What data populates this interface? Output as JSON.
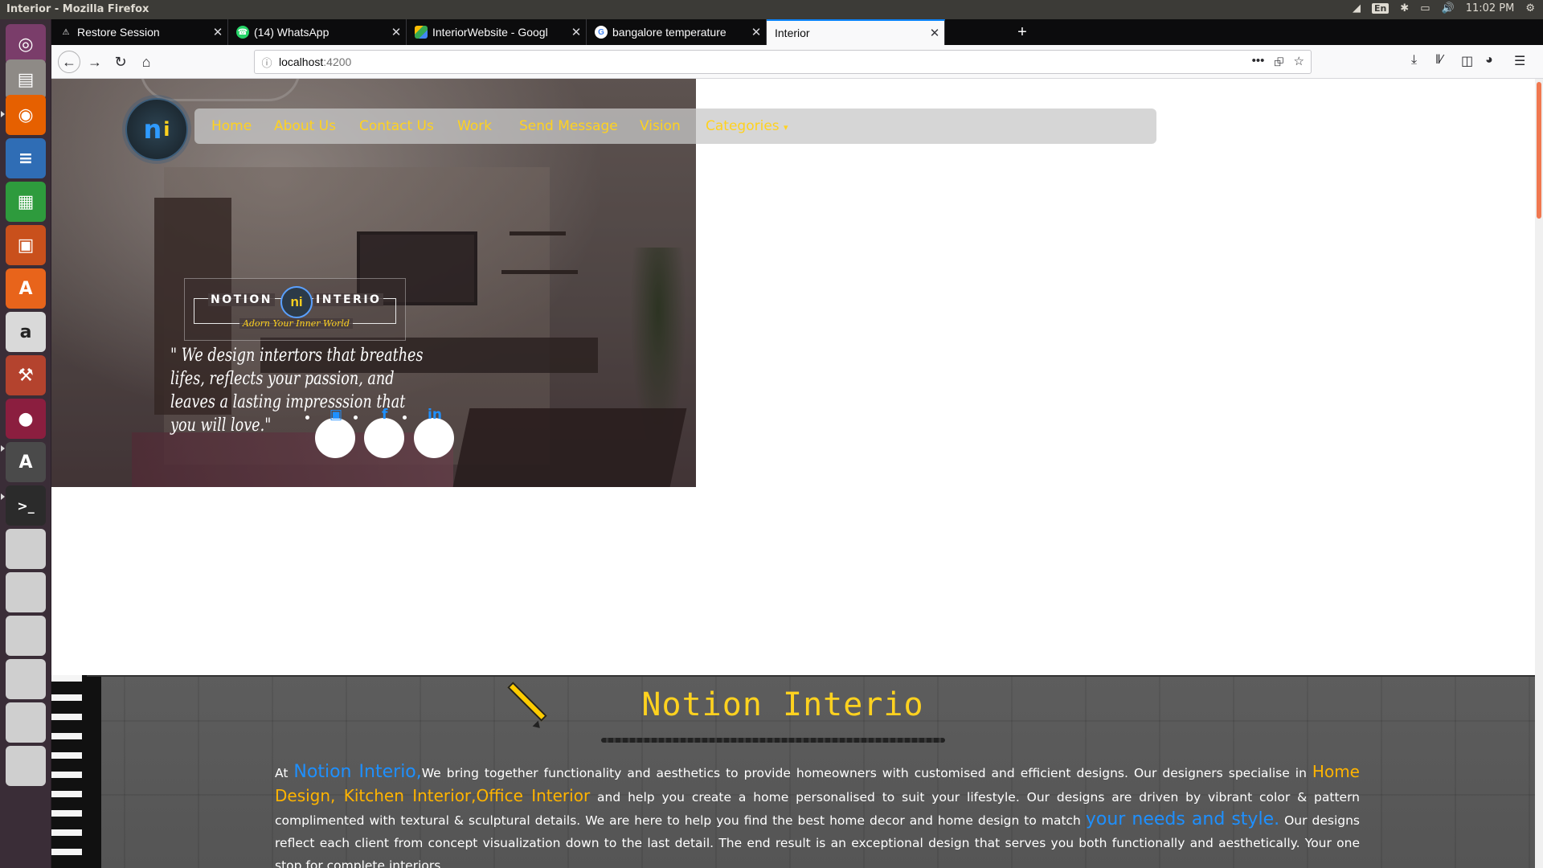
{
  "system": {
    "window_title": "Interior - Mozilla Firefox",
    "keyboard_layout": "En",
    "clock": "11:02 PM"
  },
  "browser": {
    "tabs": [
      {
        "label": "Restore Session",
        "icon": "warning-icon",
        "active": false
      },
      {
        "label": "(14) WhatsApp",
        "icon": "whatsapp-icon",
        "active": false
      },
      {
        "label": "InteriorWebsite - Googl",
        "icon": "google-drive-icon",
        "active": false
      },
      {
        "label": "bangalore temperature",
        "icon": "google-icon",
        "active": false
      },
      {
        "label": "Interior",
        "icon": "none",
        "active": true
      }
    ],
    "url_host": "localhost",
    "url_port": ":4200"
  },
  "site": {
    "nav": {
      "links": [
        "Home",
        "About Us",
        "Contact Us",
        "Work",
        "Send Message",
        "Vision",
        "Categories"
      ]
    },
    "hero": {
      "brand_left": "NOTION",
      "brand_right": "INTERIO",
      "brand_tagline": "Adorn Your Inner World",
      "quote": "\" We design intertors that breathes lifes, reflects your passion, and leaves a lasting impresssion that you will love.\""
    },
    "about": {
      "title": "Notion Interio",
      "p_at": "At ",
      "p_brand": "Notion Interio,",
      "p_1": "We bring together functionality and aesthetics to provide homeowners with customised and efficient designs. Our designers specialise in ",
      "p_services": "Home Design, Kitchen Interior,Office Interior",
      "p_2": " and help you create a home personalised to suit your lifestyle. Our designs are driven by vibrant color & pattern complimented with textural & sculptural details. We are here to help you find the best home decor and home design to match ",
      "p_needs": "your needs and style.",
      "p_3": " Our designs reflect each client from concept visualization down to the last detail. The end result is an exceptional design that serves you both functionally and aesthetically. Your one stop for complete interiors."
    }
  },
  "colors": {
    "nav_link": "#ffd21f",
    "accent_blue": "#1e90ff",
    "accent_orange": "#ffb400"
  }
}
